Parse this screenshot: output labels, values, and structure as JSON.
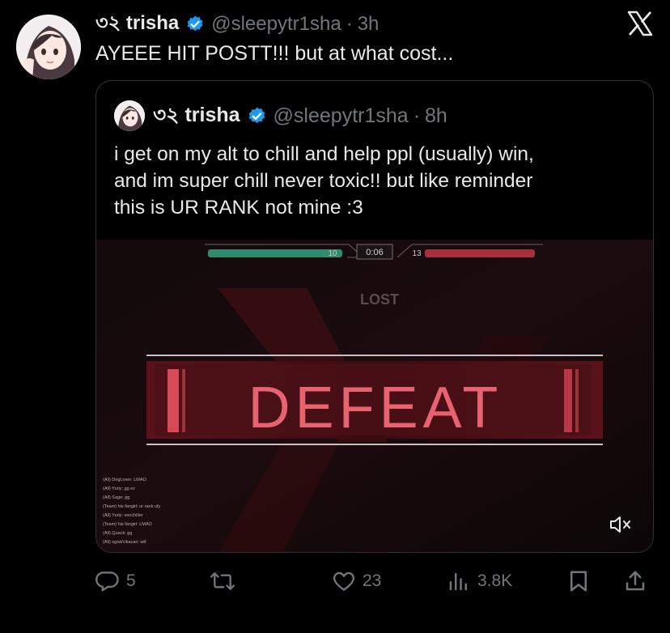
{
  "post": {
    "display_name": "৩২ trisha",
    "handle": "@sleepytr1sha",
    "separator": "·",
    "time": "3h",
    "text": "AYEEE HIT POSTT!!! but at what cost..."
  },
  "quote": {
    "display_name": "৩২ trisha",
    "handle": "@sleepytr1sha",
    "separator": "·",
    "time": "8h",
    "text_lines": [
      "i get on my alt to chill and help ppl (usually) win,",
      "and im super chill never toxic!! but like reminder",
      "this is UR RANK not mine :3"
    ],
    "media": {
      "score_left": "10",
      "timer": "0:06",
      "score_right": "13",
      "banner_text": "DEFEAT",
      "lost_text": "LOST",
      "chat_lines": [
        "(All) DogLover: LMAO",
        "(All) Yuriy: gg ez",
        "(All) Sage: gg",
        "(Team) his fangirl: ur rank ufy",
        "(All) Yuriy: senchiller",
        "(Team) his fangirl: LMAO",
        "(All) Quack: gg",
        "(All) sgod/cikacan: wtf"
      ]
    }
  },
  "actions": {
    "replies": "5",
    "reposts": "",
    "likes": "23",
    "views": "3.8K"
  },
  "colors": {
    "verified": "#1d9bf0",
    "muted_text": "#71767b",
    "team_green": "#2f8a6e",
    "team_red": "#c23a45",
    "defeat_red": "#d84a58"
  },
  "icons": [
    "x-logo-icon",
    "verified-badge-icon",
    "mute-icon",
    "reply-icon",
    "repost-icon",
    "like-icon",
    "views-icon",
    "bookmark-icon",
    "share-icon"
  ]
}
